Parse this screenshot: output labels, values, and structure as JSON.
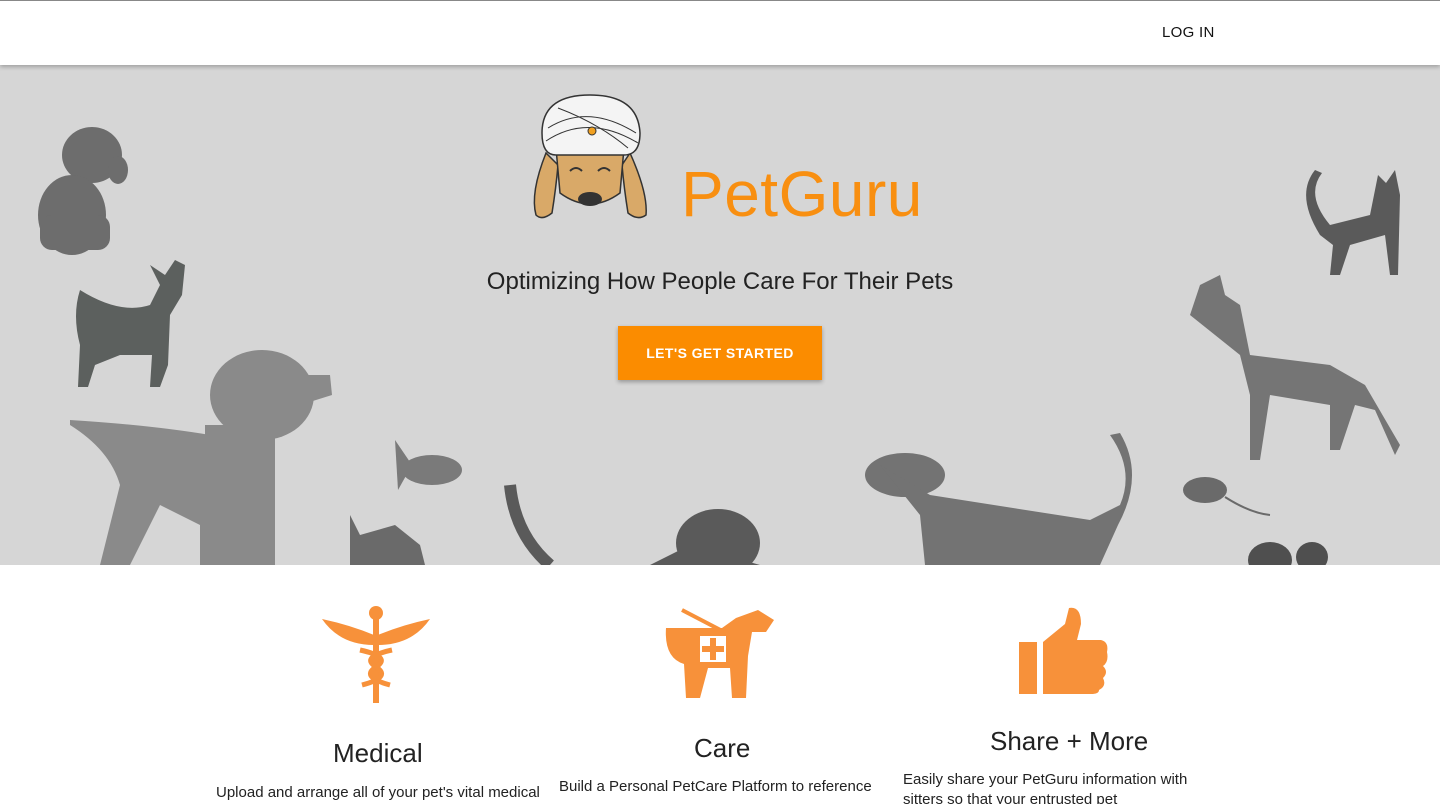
{
  "navbar": {
    "login_label": "LOG IN"
  },
  "hero": {
    "brand": "PetGuru",
    "tagline": "Optimizing How People Care For Their Pets",
    "cta_label": "LET'S GET STARTED"
  },
  "features": [
    {
      "icon": "caduceus-icon",
      "title": "Medical",
      "text": "Upload and arrange all of your pet's vital medical"
    },
    {
      "icon": "service-dog-icon",
      "title": "Care",
      "text": "Build a Personal PetCare Platform to reference"
    },
    {
      "icon": "thumbs-up-icon",
      "title": "Share + More",
      "text": "Easily share your PetGuru information with sitters so that your entrusted pet chaperones"
    }
  ],
  "colors": {
    "accent": "#fb8c00",
    "hero_bg": "#d6d6d6",
    "silhouette": "#6f6f6f"
  }
}
